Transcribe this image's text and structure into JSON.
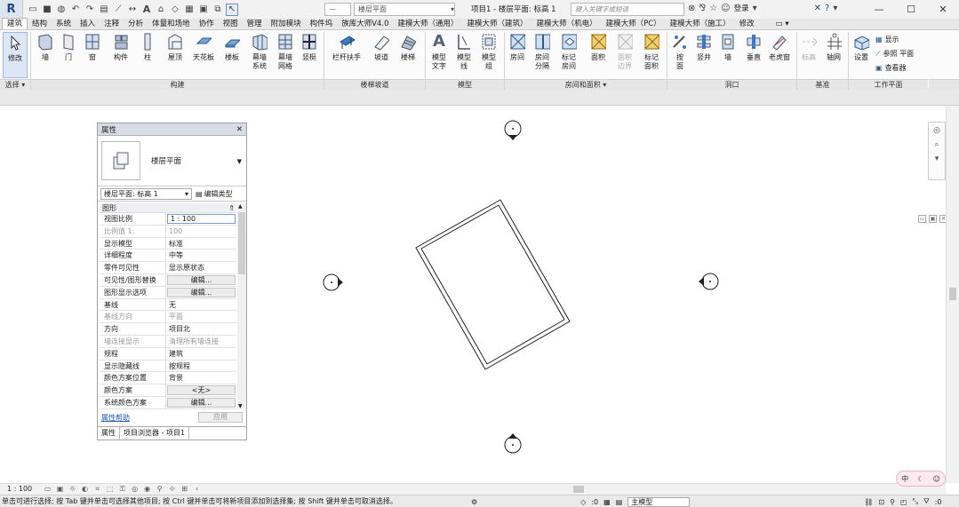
{
  "title": {
    "doc_title": "项目1 - 楼层平面: 标高 1",
    "search_placeholder": "键入关键字或短语",
    "login": "登录",
    "level_combo": "楼层平面"
  },
  "tabs": [
    "建筑",
    "结构",
    "系统",
    "插入",
    "注释",
    "分析",
    "体量和场地",
    "协作",
    "视图",
    "管理",
    "附加模块",
    "构件坞",
    "族库大师V4.0",
    "建模大师（通用）",
    "建模大师（建筑）",
    "建模大师（机电）",
    "建模大师（PC）",
    "建模大师（施工）",
    "修改"
  ],
  "ribbon": {
    "modify": "修改",
    "wall": "墙",
    "door": "门",
    "window": "窗",
    "component": "构件",
    "column": "柱",
    "roof": "屋顶",
    "ceiling": "天花板",
    "floor": "楼板",
    "curtain_system": "幕墙\n系统",
    "curtain_grid": "幕墙\n网格",
    "mullion": "竖梃",
    "railing": "栏杆扶手",
    "ramp": "坡道",
    "stair": "楼梯",
    "model_text": "模型\n文字",
    "model_line": "模型\n线",
    "model_group": "模型\n组",
    "room": "房间",
    "room_sep": "房间\n分隔",
    "tag_room": "标记\n房间",
    "area": "面积",
    "area_boundary": "面积\n边界",
    "tag_area": "标记\n面积",
    "by_face": "按\n面",
    "shaft": "竖井",
    "wall_opening": "墙",
    "vertical": "垂直",
    "dormer": "老虎窗",
    "level": "标高",
    "grid": "轴网",
    "set": "设置",
    "show": "显示",
    "ref_plane": "参照 平面",
    "viewer": "查看器",
    "panel_select": "选择",
    "panel_build": "构建",
    "panel_circulation": "楼梯坡道",
    "panel_model": "模型",
    "panel_room": "房间和面积",
    "panel_opening": "洞口",
    "panel_datum": "基准",
    "panel_workplane": "工作平面"
  },
  "properties": {
    "title": "属性",
    "type_name": "楼层平面",
    "instance_selector": "楼层平面: 标高 1",
    "edit_type": "编辑类型",
    "group": "图形",
    "rows": [
      {
        "k": "视图比例",
        "v": "1 : 100",
        "style": "boxed"
      },
      {
        "k": "比例值 1:",
        "v": "100",
        "style": "dim"
      },
      {
        "k": "显示模型",
        "v": "标准",
        "style": ""
      },
      {
        "k": "详细程度",
        "v": "中等",
        "style": ""
      },
      {
        "k": "零件可见性",
        "v": "显示原状态",
        "style": ""
      },
      {
        "k": "可见性/图形替换",
        "v": "编辑...",
        "style": "btn"
      },
      {
        "k": "图形显示选项",
        "v": "编辑...",
        "style": "btn"
      },
      {
        "k": "基线",
        "v": "无",
        "style": ""
      },
      {
        "k": "基线方向",
        "v": "平面",
        "style": "dim"
      },
      {
        "k": "方向",
        "v": "项目北",
        "style": ""
      },
      {
        "k": "墙连接显示",
        "v": "清理所有墙连接",
        "style": "dim"
      },
      {
        "k": "规程",
        "v": "建筑",
        "style": ""
      },
      {
        "k": "显示隐藏线",
        "v": "按规程",
        "style": ""
      },
      {
        "k": "颜色方案位置",
        "v": "背景",
        "style": ""
      },
      {
        "k": "颜色方案",
        "v": "<无>",
        "style": "btn"
      },
      {
        "k": "系统颜色方案",
        "v": "编辑...",
        "style": "btn"
      }
    ],
    "help": "属性帮助",
    "apply": "应用",
    "tab_props": "属性",
    "tab_browser": "项目浏览器 - 项目1"
  },
  "view": {
    "scale": "1 : 100"
  },
  "status": {
    "text": "单击可进行选择; 按 Tab 键并单击可选择其他项目; 按 Ctrl 键并单击可将新项目添加到选择集; 按 Shift 键并单击可取消选择。",
    "zero1": ":0",
    "main_model": "主模型",
    "zero2": ":0"
  },
  "ime": {
    "label": "中"
  },
  "colors": {
    "accent": "#1b4a8a",
    "ribbon_blue": "#3b78c8"
  }
}
